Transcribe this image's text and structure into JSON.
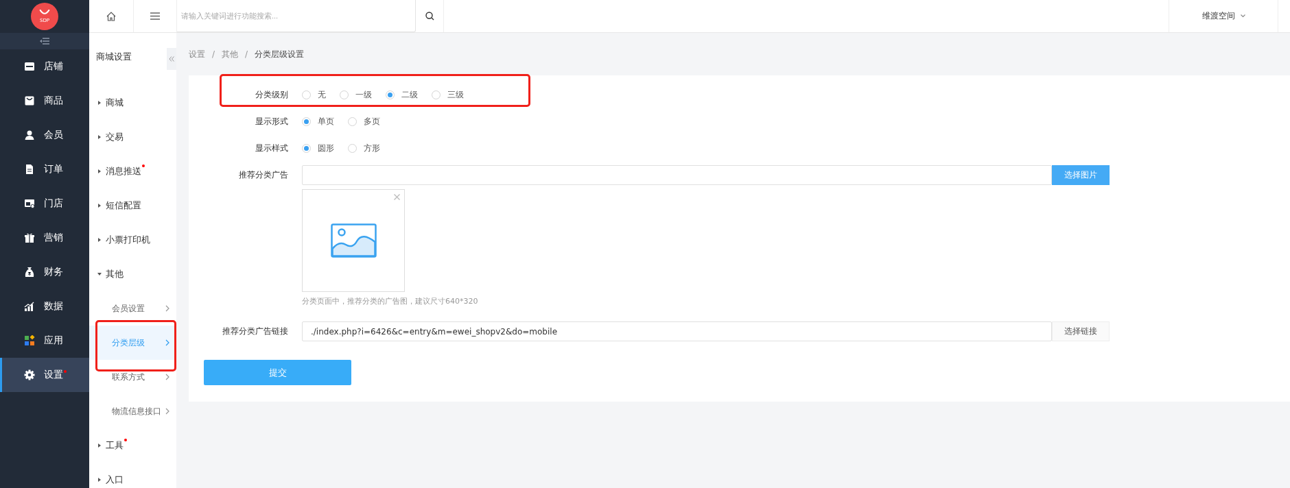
{
  "logo": {
    "text": "SDP"
  },
  "nav": [
    {
      "label": "店铺",
      "selected": false,
      "badge_dot": false
    },
    {
      "label": "商品",
      "selected": false,
      "badge_dot": false
    },
    {
      "label": "会员",
      "selected": false,
      "badge_dot": false
    },
    {
      "label": "订单",
      "selected": false,
      "badge_dot": false
    },
    {
      "label": "门店",
      "selected": false,
      "badge_dot": false
    },
    {
      "label": "营销",
      "selected": false,
      "badge_dot": false
    },
    {
      "label": "财务",
      "selected": false,
      "badge_dot": false
    },
    {
      "label": "数据",
      "selected": false,
      "badge_dot": false
    },
    {
      "label": "应用",
      "selected": false,
      "badge_dot": false
    },
    {
      "label": "设置",
      "selected": true,
      "badge_dot": true
    }
  ],
  "topbar": {
    "search": {
      "placeholder": "请输入关键词进行功能搜索..."
    },
    "user": "维渡空间"
  },
  "subnav": {
    "title": "商城设置",
    "items": [
      {
        "label": "商城",
        "expanded": false,
        "badge_dot": false
      },
      {
        "label": "交易",
        "expanded": false,
        "badge_dot": false
      },
      {
        "label": "消息推送",
        "expanded": false,
        "badge_dot": true
      },
      {
        "label": "短信配置",
        "expanded": false,
        "badge_dot": false
      },
      {
        "label": "小票打印机",
        "expanded": false,
        "badge_dot": false
      },
      {
        "label": "其他",
        "expanded": true,
        "badge_dot": false,
        "children": [
          {
            "label": "会员设置",
            "selected": false,
            "annotation_frame": false
          },
          {
            "label": "分类层级",
            "selected": true,
            "annotation_frame": true
          },
          {
            "label": "联系方式",
            "selected": false,
            "annotation_frame": false
          },
          {
            "label": "物流信息接口",
            "selected": false,
            "annotation_frame": false
          }
        ]
      },
      {
        "label": "工具",
        "expanded": false,
        "badge_dot": true
      },
      {
        "label": "入口",
        "expanded": false,
        "badge_dot": false
      }
    ]
  },
  "breadcrumb": {
    "items": [
      "设置",
      "其他",
      "分类层级设置"
    ],
    "separators": [
      "/",
      "/"
    ]
  },
  "form": {
    "radio_groups": [
      {
        "label": "分类级别",
        "annotation_frame": true,
        "options": [
          {
            "label": "无",
            "selected": false
          },
          {
            "label": "一级",
            "selected": false
          },
          {
            "label": "二级",
            "selected": true
          },
          {
            "label": "三级",
            "selected": false
          }
        ]
      },
      {
        "label": "显示形式",
        "annotation_frame": false,
        "options": [
          {
            "label": "单页",
            "selected": true
          },
          {
            "label": "多页",
            "selected": false
          }
        ]
      },
      {
        "label": "显示样式",
        "annotation_frame": false,
        "options": [
          {
            "label": "圆形",
            "selected": true
          },
          {
            "label": "方形",
            "selected": false
          }
        ]
      }
    ],
    "ad_image": {
      "label": "推荐分类广告",
      "button": "选择图片",
      "hint": "分类页面中，推荐分类的广告图，建议尺寸640*320"
    },
    "ad_link": {
      "label": "推荐分类广告链接",
      "value": "./index.php?i=6426&c=entry&m=ewei_shopv2&do=mobile",
      "button": "选择链接"
    },
    "submit": "提交"
  }
}
